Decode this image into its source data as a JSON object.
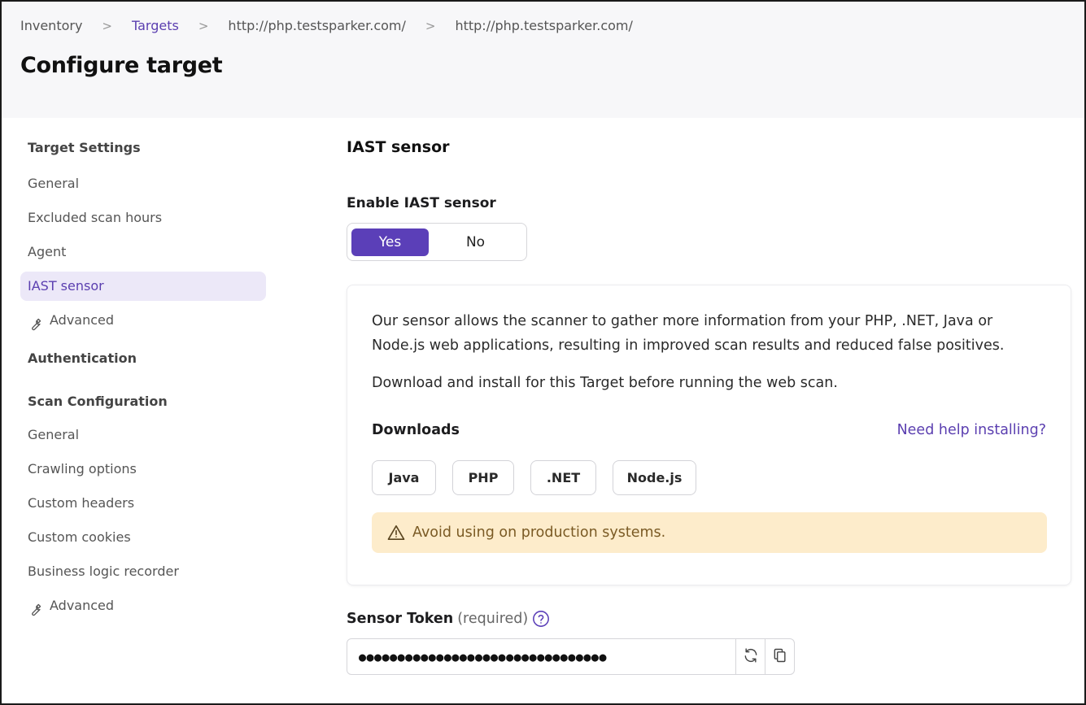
{
  "breadcrumb": [
    {
      "label": "Inventory",
      "link": false
    },
    {
      "label": "Targets",
      "link": true
    },
    {
      "label": "http://php.testsparker.com/",
      "link": false
    },
    {
      "label": "http://php.testsparker.com/",
      "link": false
    }
  ],
  "breadcrumb_separator": ">",
  "page_title": "Configure target",
  "sidebar": {
    "target_settings": {
      "heading": "Target Settings",
      "items": [
        {
          "label": "General"
        },
        {
          "label": "Excluded scan hours"
        },
        {
          "label": "Agent"
        },
        {
          "label": "IAST sensor",
          "active": true
        },
        {
          "label": "Advanced",
          "icon": "wrench-icon"
        }
      ]
    },
    "authentication": {
      "heading": "Authentication"
    },
    "scan_configuration": {
      "heading": "Scan Configuration",
      "items": [
        {
          "label": "General"
        },
        {
          "label": "Crawling options"
        },
        {
          "label": "Custom headers"
        },
        {
          "label": "Custom cookies"
        },
        {
          "label": "Business logic recorder"
        },
        {
          "label": "Advanced",
          "icon": "wrench-icon"
        }
      ]
    }
  },
  "main": {
    "section_title": "IAST sensor",
    "enable_label": "Enable IAST sensor",
    "toggle": {
      "yes": "Yes",
      "no": "No",
      "selected": "Yes"
    },
    "info": {
      "paragraph1_line1": "Our sensor allows the scanner to gather more information from your PHP, .NET, Java or",
      "paragraph1_line2": "Node.js web applications, resulting in improved scan results and reduced false positives.",
      "paragraph2": "Download and install for this Target before running the web scan.",
      "downloads_label": "Downloads",
      "help_link": "Need help installing?",
      "downloads": [
        "Java",
        "PHP",
        ".NET",
        "Node.js"
      ],
      "warning": "Avoid using on production systems."
    },
    "token": {
      "label": "Sensor Token",
      "required": "(required)",
      "value": "●●●●●●●●●●●●●●●●●●●●●●●●●●●●●●●●"
    }
  },
  "colors": {
    "accent": "#5b3fb8",
    "active_bg": "#ece8f8",
    "warning_bg": "#fdeccb",
    "header_bg": "#f7f7f9"
  }
}
